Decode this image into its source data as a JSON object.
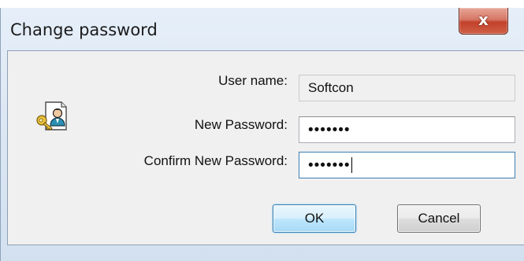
{
  "window": {
    "title": "Change password",
    "close_glyph": "x"
  },
  "icon": "user-key-icon",
  "form": {
    "user_name_label": "User name:",
    "user_name_value": "Softcon",
    "new_password_label": "New Password:",
    "new_password_value": "•••••••",
    "confirm_password_label": "Confirm New Password:",
    "confirm_password_value": "•••••••"
  },
  "buttons": {
    "ok_label": "OK",
    "cancel_label": "Cancel"
  },
  "colors": {
    "focus_border": "#3c7fb1",
    "close_red": "#c2412b"
  }
}
